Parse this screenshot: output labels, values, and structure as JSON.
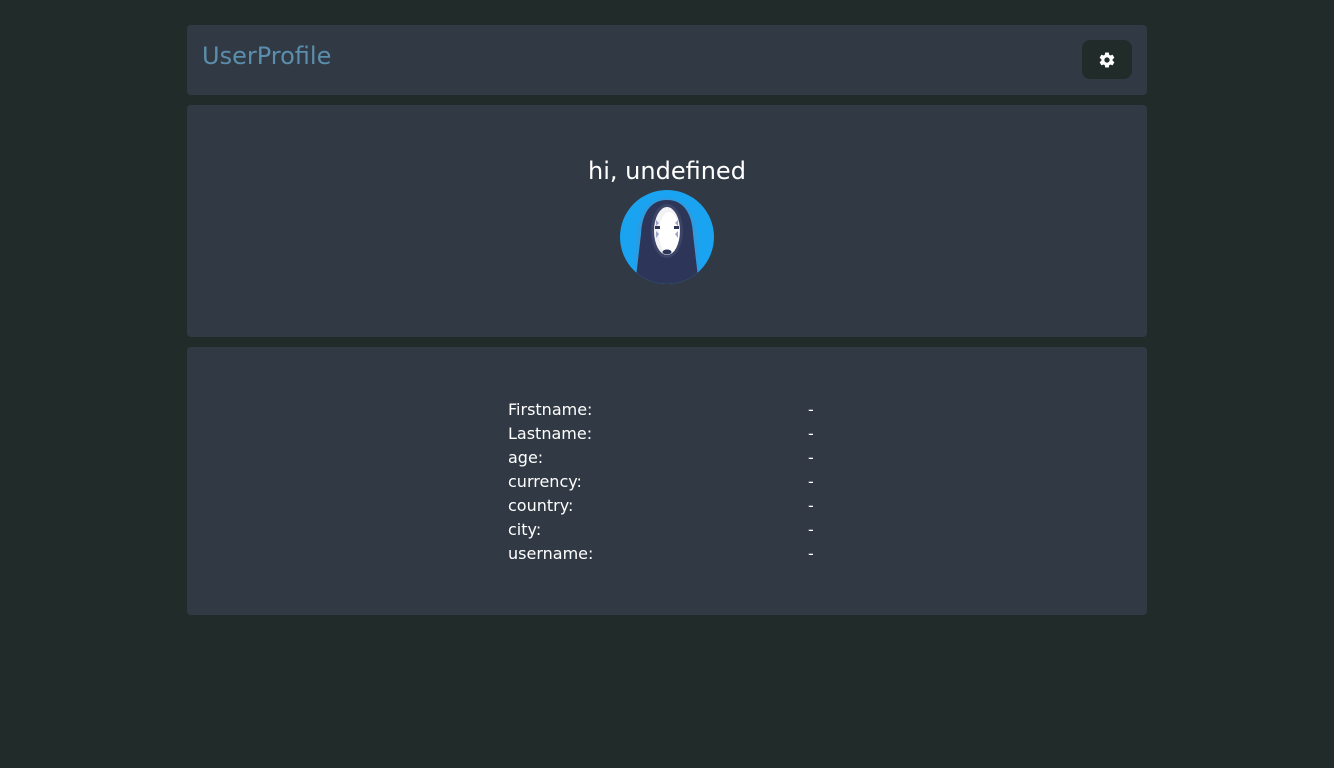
{
  "header": {
    "title": "UserProfile",
    "settings_icon": "gear-icon"
  },
  "greeting": {
    "text": "hi, undefined",
    "avatar_icon": "no-face-avatar"
  },
  "profile": {
    "rows": [
      {
        "label": "Firstname:",
        "value": "-"
      },
      {
        "label": "Lastname:",
        "value": "-"
      },
      {
        "label": "age:",
        "value": "-"
      },
      {
        "label": "currency:",
        "value": "-"
      },
      {
        "label": "country:",
        "value": "-"
      },
      {
        "label": "city:",
        "value": "-"
      },
      {
        "label": "username:",
        "value": "-"
      }
    ]
  },
  "colors": {
    "background": "#212b2a",
    "card": "#313a44",
    "title": "#5b8eac",
    "avatar_ring": "#1aa3f0"
  }
}
